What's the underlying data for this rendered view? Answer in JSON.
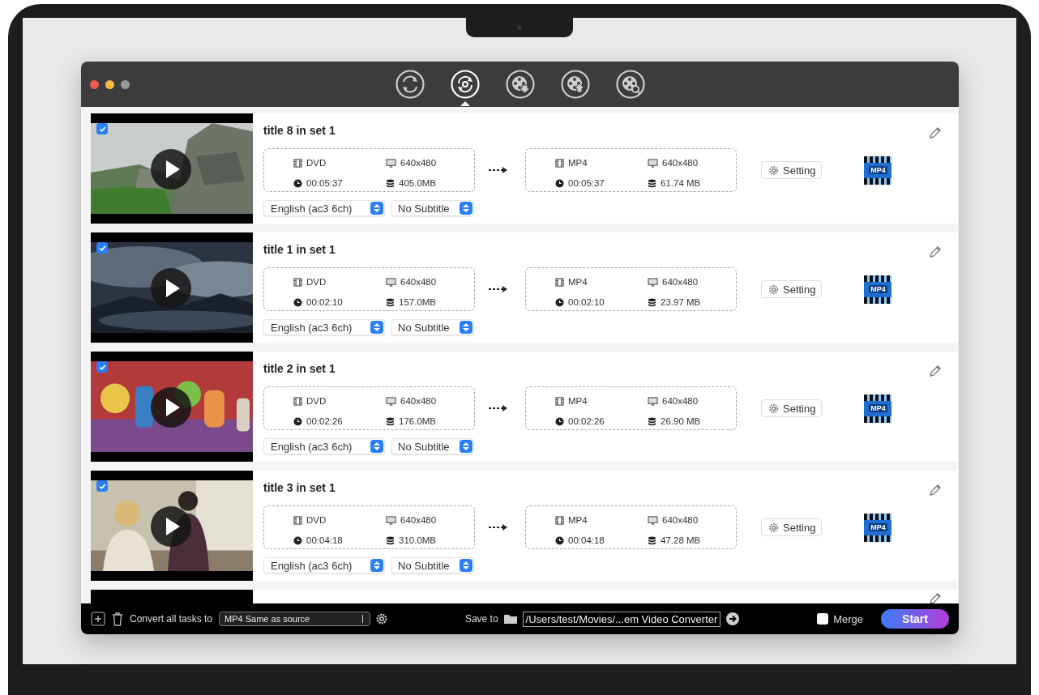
{
  "toolbar": [
    {
      "kind": "convert",
      "selected": false
    },
    {
      "kind": "rotate",
      "selected": true
    },
    {
      "kind": "film-down",
      "selected": false
    },
    {
      "kind": "film-up",
      "selected": false
    },
    {
      "kind": "film-search",
      "selected": false
    }
  ],
  "tasks": [
    {
      "checked": true,
      "title": "title 8 in set 1",
      "source": {
        "format": "DVD",
        "resolution": "640x480",
        "duration": "00:05:37",
        "size": "405.0MB"
      },
      "target": {
        "format": "MP4",
        "resolution": "640x480",
        "duration": "00:05:37",
        "size": "61.74 MB"
      },
      "setting": "Setting",
      "badge": "MP4",
      "audio": "English (ac3 6ch)",
      "subtitle": "No Subtitle"
    },
    {
      "checked": true,
      "title": "title 1 in set 1",
      "source": {
        "format": "DVD",
        "resolution": "640x480",
        "duration": "00:02:10",
        "size": "157.0MB"
      },
      "target": {
        "format": "MP4",
        "resolution": "640x480",
        "duration": "00:02:10",
        "size": "23.97 MB"
      },
      "setting": "Setting",
      "badge": "MP4",
      "audio": "English (ac3 6ch)",
      "subtitle": "No Subtitle"
    },
    {
      "checked": true,
      "title": "title 2 in set 1",
      "source": {
        "format": "DVD",
        "resolution": "640x480",
        "duration": "00:02:26",
        "size": "176.0MB"
      },
      "target": {
        "format": "MP4",
        "resolution": "640x480",
        "duration": "00:02:26",
        "size": "26.90 MB"
      },
      "setting": "Setting",
      "badge": "MP4",
      "audio": "English (ac3 6ch)",
      "subtitle": "No Subtitle"
    },
    {
      "checked": true,
      "title": "title 3 in set 1",
      "source": {
        "format": "DVD",
        "resolution": "640x480",
        "duration": "00:04:18",
        "size": "310.0MB"
      },
      "target": {
        "format": "MP4",
        "resolution": "640x480",
        "duration": "00:04:18",
        "size": "47.28 MB"
      },
      "setting": "Setting",
      "badge": "MP4",
      "audio": "English (ac3 6ch)",
      "subtitle": "No Subtitle"
    }
  ],
  "bottom_bar": {
    "convert_label": "Convert all tasks to",
    "profile": "MP4 Same as source",
    "save_label": "Save to",
    "path": "/Users/test/Movies/...em Video Converter",
    "merge": {
      "label": "Merge",
      "checked": false
    },
    "start": "Start"
  }
}
